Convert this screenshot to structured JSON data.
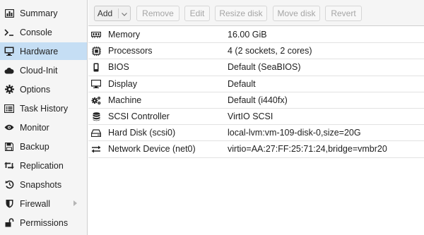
{
  "sidebar": {
    "items": [
      {
        "label": "Summary",
        "icon": "summary-icon",
        "selected": false
      },
      {
        "label": "Console",
        "icon": "console-icon",
        "selected": false
      },
      {
        "label": "Hardware",
        "icon": "monitor-icon",
        "selected": true
      },
      {
        "label": "Cloud-Init",
        "icon": "cloud-icon",
        "selected": false
      },
      {
        "label": "Options",
        "icon": "gear-icon",
        "selected": false
      },
      {
        "label": "Task History",
        "icon": "list-icon",
        "selected": false
      },
      {
        "label": "Monitor",
        "icon": "eye-icon",
        "selected": false
      },
      {
        "label": "Backup",
        "icon": "floppy-icon",
        "selected": false
      },
      {
        "label": "Replication",
        "icon": "retweet-icon",
        "selected": false
      },
      {
        "label": "Snapshots",
        "icon": "history-icon",
        "selected": false
      },
      {
        "label": "Firewall",
        "icon": "shield-icon",
        "selected": false,
        "has_submenu": true
      },
      {
        "label": "Permissions",
        "icon": "unlock-icon",
        "selected": false
      }
    ],
    "selected_color": "#c5def4"
  },
  "toolbar": {
    "add_label": "Add",
    "remove_label": "Remove",
    "edit_label": "Edit",
    "resize_label": "Resize disk",
    "move_label": "Move disk",
    "revert_label": "Revert"
  },
  "hardware": {
    "rows": [
      {
        "key": "Memory",
        "value": "16.00 GiB",
        "icon": "memory-icon"
      },
      {
        "key": "Processors",
        "value": "4 (2 sockets, 2 cores)",
        "icon": "cpu-icon"
      },
      {
        "key": "BIOS",
        "value": "Default (SeaBIOS)",
        "icon": "bios-icon"
      },
      {
        "key": "Display",
        "value": "Default",
        "icon": "display-icon"
      },
      {
        "key": "Machine",
        "value": "Default (i440fx)",
        "icon": "cogs-icon"
      },
      {
        "key": "SCSI Controller",
        "value": "VirtIO SCSI",
        "icon": "database-icon"
      },
      {
        "key": "Hard Disk (scsi0)",
        "value": "local-lvm:vm-109-disk-0,size=20G",
        "icon": "hdd-icon"
      },
      {
        "key": "Network Device (net0)",
        "value": "virtio=AA:27:FF:25:71:24,bridge=vmbr20",
        "icon": "exchange-icon"
      }
    ]
  }
}
